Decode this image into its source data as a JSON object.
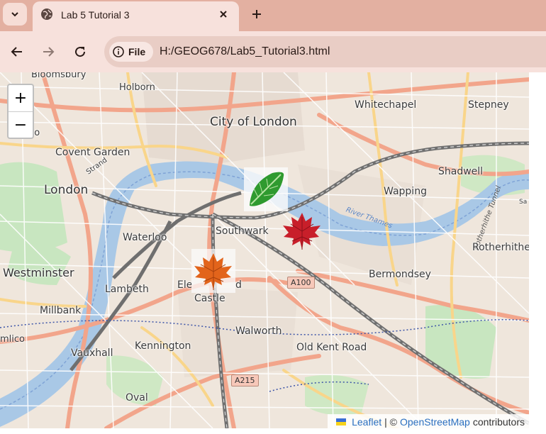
{
  "browser": {
    "tab_title": "Lab 5 Tutorial 3",
    "chip_label": "File",
    "url": "H:/GEOG678/Lab5_Tutorial3.html",
    "accent_color": "#e3b0a1"
  },
  "map": {
    "zoom_in": "+",
    "zoom_out": "−",
    "labels": {
      "bloomsbury": "Bloomsbury",
      "holborn": "Holborn",
      "whitechapel": "Whitechapel",
      "stepney": "Stepney",
      "city_of_london": "City of London",
      "covent_garden": "Covent Garden",
      "strand": "Strand",
      "london": "London",
      "shadwell": "Shadwell",
      "wapping": "Wapping",
      "southwark": "Southwark",
      "waterloo": "Waterloo",
      "westminster": "Westminster",
      "lambeth": "Lambeth",
      "rotherhithe": "Rotherhithe",
      "bermondsey": "Bermondsey",
      "elephant_a": "Ele",
      "elephant_b": "d",
      "castle": "Castle",
      "millbank": "Millbank",
      "walworth": "Walworth",
      "kennington": "Kennington",
      "old_kent_road": "Old Kent Road",
      "vauxhall": "Vauxhall",
      "oval": "Oval",
      "milico": "mlico",
      "bo": "bo",
      "sa": "Sa",
      "river_thames": "River Thames",
      "rotherhithe_tunnel": "Rotherhithe Tunnel"
    },
    "road_shields": {
      "a100": "A100",
      "a215": "A215"
    },
    "markers": [
      {
        "name": "green leaf",
        "icon": "green-leaf-icon"
      },
      {
        "name": "red maple leaf",
        "icon": "red-maple-leaf-icon"
      },
      {
        "name": "orange maple leaf",
        "icon": "orange-maple-leaf-icon"
      }
    ],
    "attribution": {
      "leaflet": "Leaflet",
      "separator": "| ©",
      "osm": "OpenStreetMap",
      "suffix": "contributors"
    }
  }
}
